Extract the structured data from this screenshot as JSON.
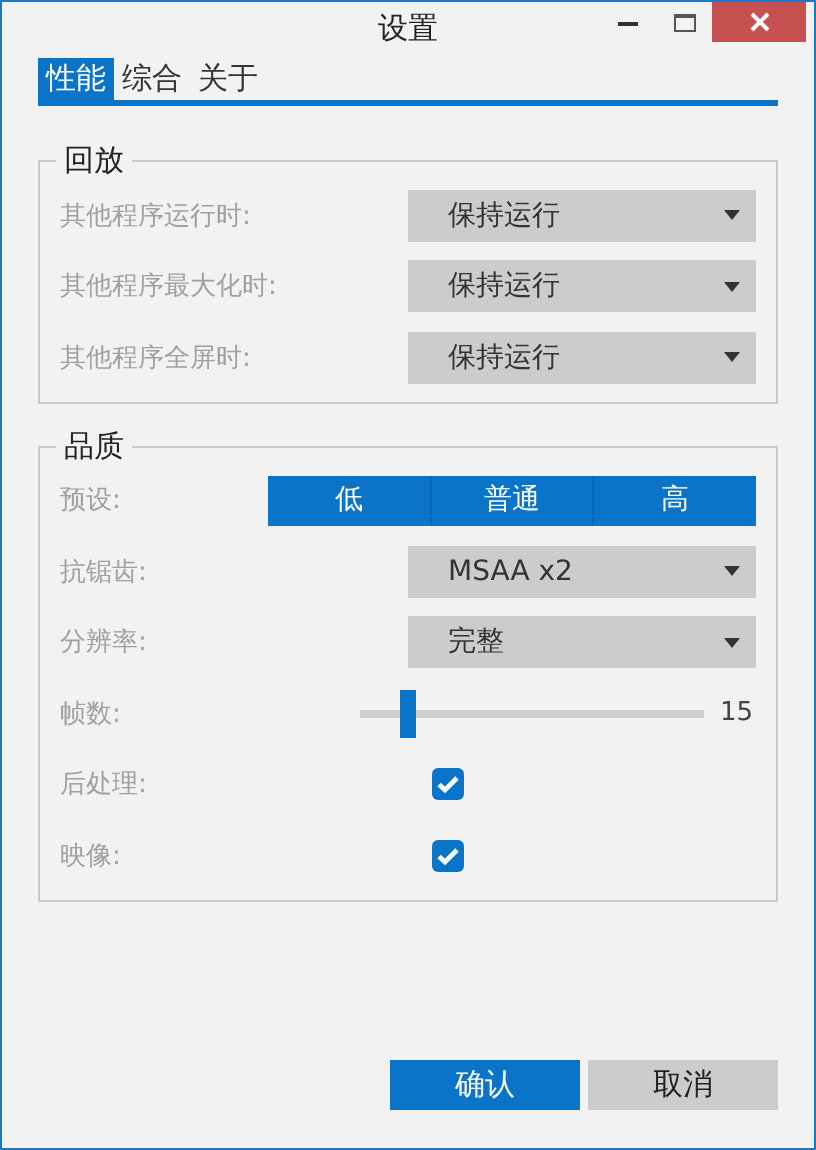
{
  "window": {
    "title": "设置"
  },
  "tabs": [
    {
      "label": "性能",
      "selected": true
    },
    {
      "label": "综合",
      "selected": false
    },
    {
      "label": "关于",
      "selected": false
    }
  ],
  "playback": {
    "title": "回放",
    "rows": [
      {
        "label": "其他程序运行时:",
        "value": "保持运行"
      },
      {
        "label": "其他程序最大化时:",
        "value": "保持运行"
      },
      {
        "label": "其他程序全屏时:",
        "value": "保持运行"
      }
    ]
  },
  "quality": {
    "title": "品质",
    "rows": [
      {
        "kind": "segmented",
        "label": "预设:",
        "options": [
          "低",
          "普通",
          "高"
        ]
      },
      {
        "kind": "combo",
        "label": "抗锯齿:",
        "value": "MSAA x2"
      },
      {
        "kind": "combo",
        "label": "分辨率:",
        "value": "完整"
      },
      {
        "kind": "slider",
        "label": "帧数:",
        "level": 0.12,
        "reading": "15"
      },
      {
        "kind": "checkbox",
        "label": "后处理:",
        "checked": true
      },
      {
        "kind": "checkbox",
        "label": "映像:",
        "checked": true
      }
    ]
  },
  "buttons": [
    {
      "label": "确认",
      "kind": "primary"
    },
    {
      "label": "取消",
      "kind": "secondary"
    }
  ]
}
